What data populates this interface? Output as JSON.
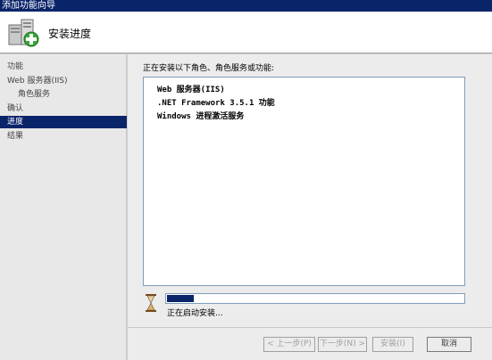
{
  "window": {
    "title": "添加功能向导"
  },
  "header": {
    "title": "安装进度",
    "icon": "server-add-icon"
  },
  "sidebar": {
    "items": [
      {
        "label": "功能",
        "active": false,
        "sub": false
      },
      {
        "label": "Web 服务器(IIS)",
        "active": false,
        "sub": false
      },
      {
        "label": "角色服务",
        "active": false,
        "sub": true
      },
      {
        "label": "确认",
        "active": false,
        "sub": false
      },
      {
        "label": "进度",
        "active": true,
        "sub": false
      },
      {
        "label": "结果",
        "active": false,
        "sub": false
      }
    ]
  },
  "main": {
    "intro": "正在安装以下角色、角色服务或功能:",
    "items": [
      "Web 服务器(IIS)",
      ".NET Framework 3.5.1 功能",
      "Windows 进程激活服务"
    ],
    "progress": {
      "value": 0.09,
      "status": "正在启动安装..."
    }
  },
  "footer": {
    "prev": "< 上一步(P)",
    "next": "下一步(N) >",
    "install": "安装(I)",
    "cancel": "取消"
  },
  "colors": {
    "accent": "#0a246a",
    "progress": "#0a246a"
  }
}
